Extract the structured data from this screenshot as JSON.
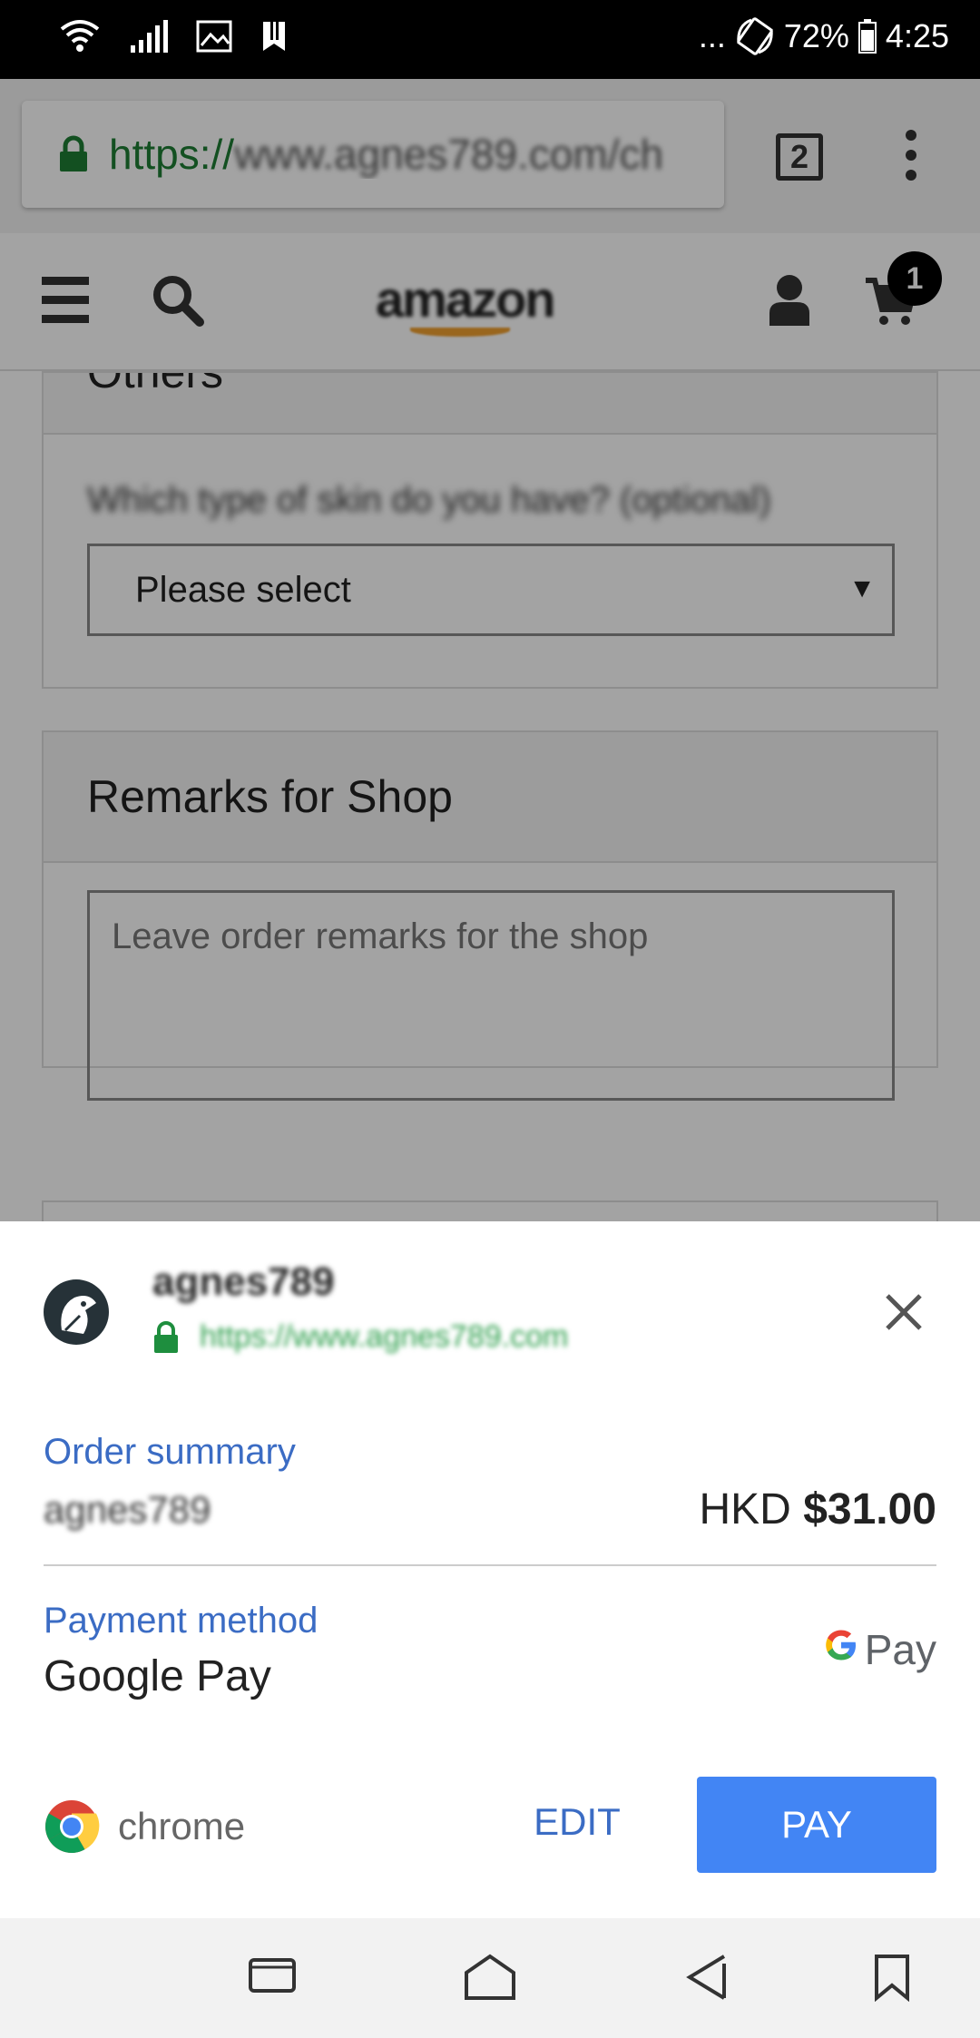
{
  "status_bar": {
    "dots": "...",
    "battery": "72%",
    "time": "4:25"
  },
  "browser": {
    "url_secure": "https://",
    "url_rest": "www.agnes789.com/ch",
    "tab_count": "2"
  },
  "site": {
    "logo_text": "amazon",
    "cart_count": "1"
  },
  "form": {
    "others_title": "Others",
    "others_field_label": "Which type of skin do you have? (optional)",
    "select_value": "Please select",
    "remarks_title": "Remarks for Shop",
    "remarks_placeholder": "Leave order remarks for the shop"
  },
  "payment_sheet": {
    "merchant_name": "agnes789",
    "merchant_url": "https://www.agnes789.com",
    "order_summary_label": "Order summary",
    "order_item": "agnes789",
    "currency": "HKD",
    "amount": "$31.00",
    "payment_method_label": "Payment method",
    "payment_method_value": "Google Pay",
    "gpay_g": "G",
    "gpay_text": "Pay",
    "chrome_label": "chrome",
    "edit_label": "EDIT",
    "pay_label": "PAY"
  },
  "colors": {
    "accent_blue": "#4285f4",
    "label_blue": "#3b6cc4",
    "secure_green": "#1e7d34"
  }
}
